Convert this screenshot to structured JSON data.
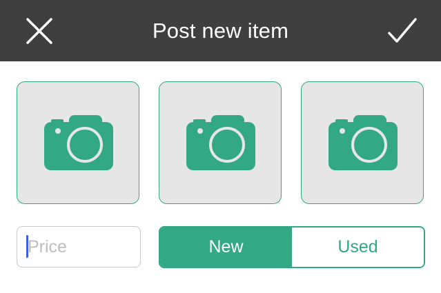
{
  "header": {
    "title": "Post new item",
    "close_icon": "close-icon",
    "confirm_icon": "checkmark-icon",
    "background_color": "#3f3f3f"
  },
  "photos": {
    "slots": [
      {
        "icon": "camera-icon"
      },
      {
        "icon": "camera-icon"
      },
      {
        "icon": "camera-icon"
      }
    ],
    "accent_color": "#32a885",
    "tile_color": "#e6e6e6"
  },
  "price": {
    "placeholder": "Price",
    "value": ""
  },
  "condition": {
    "options": [
      "New",
      "Used"
    ],
    "selected": "New"
  }
}
